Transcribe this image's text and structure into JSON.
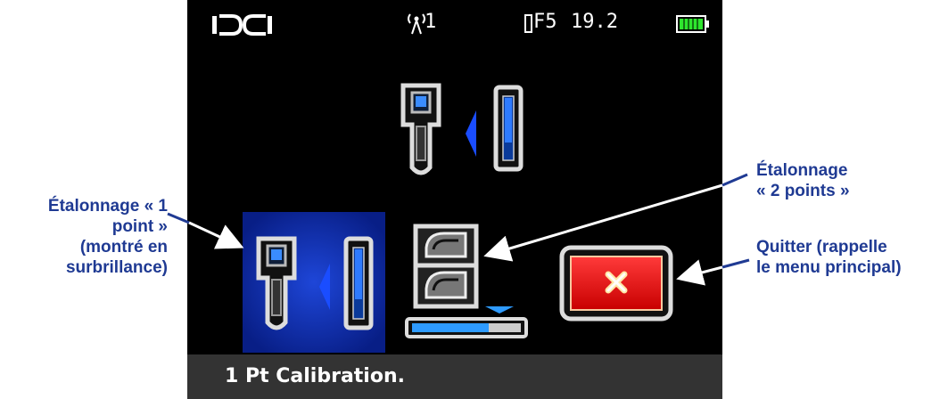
{
  "status": {
    "logo": "DCI",
    "signal_icon": "antenna-icon",
    "channel": "1",
    "frequency": "F5",
    "value": "19.2",
    "battery_icon": "battery-full-icon",
    "battery_color": "#2ee62e"
  },
  "menu": {
    "items": [
      {
        "name": "1-point-calibration",
        "icon": "one-point-calibration-icon",
        "selected": true
      },
      {
        "name": "2-point-calibration",
        "icon": "two-point-calibration-icon",
        "selected": false
      },
      {
        "name": "exit",
        "icon": "exit-icon",
        "selected": false
      }
    ],
    "highlight_color": "#0a2aa8"
  },
  "footer": {
    "text": "1 Pt Calibration."
  },
  "annotations": {
    "one_point_line1": "Étalonnage « 1",
    "one_point_line2": "point »",
    "one_point_line3": "(montré en",
    "one_point_line4": "surbrillance)",
    "two_point_line1": "Étalonnage",
    "two_point_line2": "« 2 points »",
    "exit_line1": "Quitter (rappelle",
    "exit_line2": "le menu principal)"
  }
}
